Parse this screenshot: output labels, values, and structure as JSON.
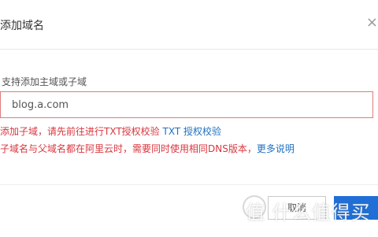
{
  "dialog": {
    "title": "添加域名",
    "close_glyph": "×",
    "field_label": "支持添加主域或子域",
    "input_value": "blog.a.com",
    "error_line1_text": "添加子域，请先前往进行TXT授权校验 ",
    "error_line1_link": "TXT 授权校验",
    "error_line2_text": "子域名与父域名都在阿里云时，需要同时使用相同DNS版本，",
    "error_line2_link": "更多说明",
    "cancel_label": "取消",
    "watermark_text": "值 什么值得买"
  },
  "colors": {
    "error": "#d9363e",
    "link": "#1f70c1",
    "primary": "#1f6fd6",
    "input_border": "#e07b7b"
  }
}
